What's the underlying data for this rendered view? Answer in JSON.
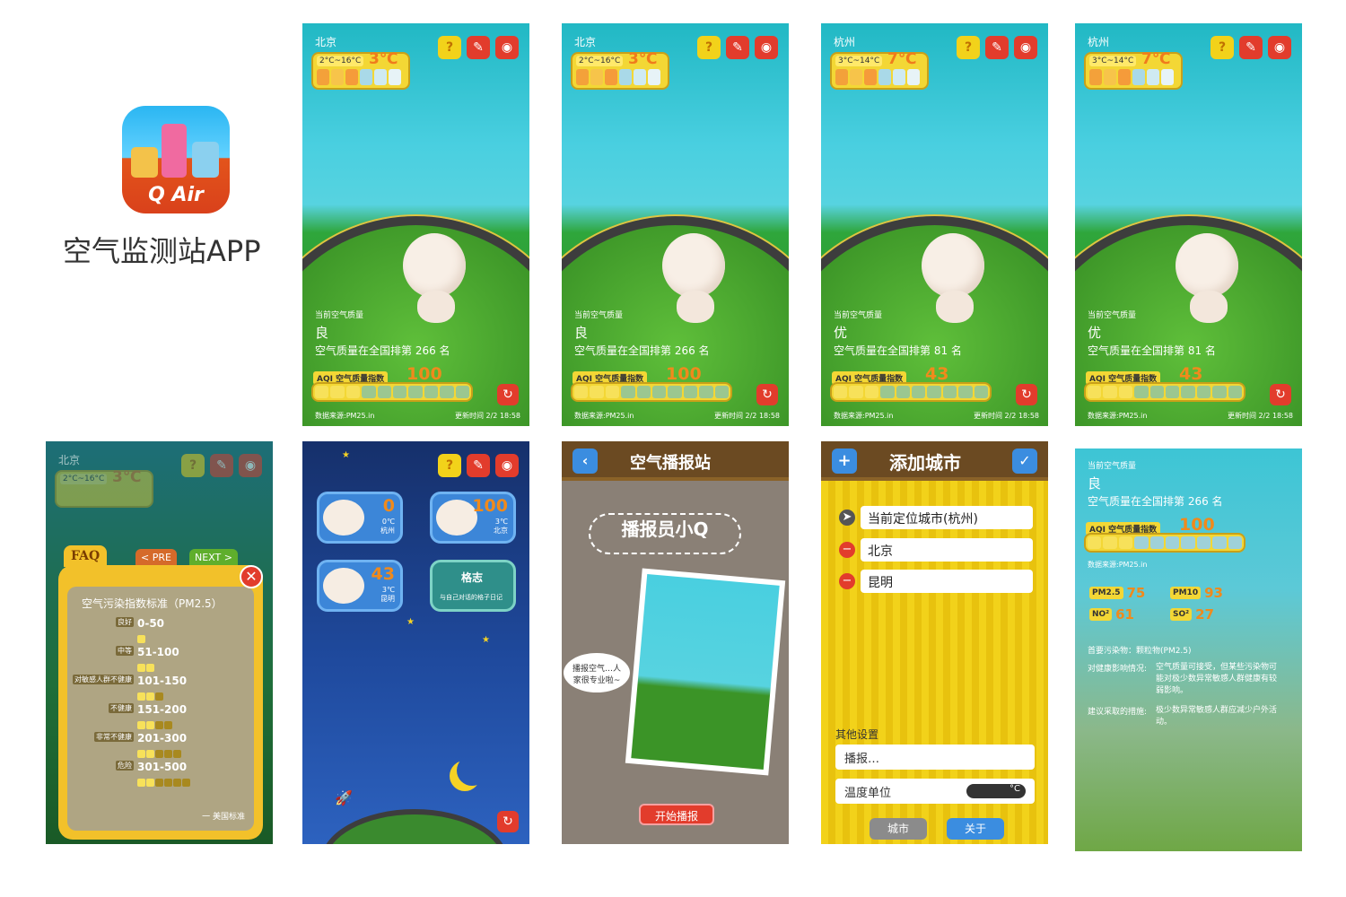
{
  "app": {
    "name": "空气监测站APP",
    "logo_text": "Q Air"
  },
  "icons": {
    "help": "?",
    "settings": "✎",
    "share": "◉",
    "refresh": "↻"
  },
  "screens": [
    {
      "city": "北京",
      "temp_range": "2°C~16°C",
      "temp": "3℃",
      "label": "当前空气质量",
      "level": "良",
      "rank": "空气质量在全国排第 266 名",
      "aqi_label": "AQI 空气质量指数",
      "aqi": "100",
      "source": "数据来源:PM25.in",
      "updated": "更新时间 2/2 18:58"
    },
    {
      "city": "北京",
      "temp_range": "2°C~16°C",
      "temp": "3℃",
      "label": "当前空气质量",
      "level": "良",
      "rank": "空气质量在全国排第 266 名",
      "aqi_label": "AQI 空气质量指数",
      "aqi": "100",
      "source": "数据来源:PM25.in",
      "updated": "更新时间 2/2 18:58"
    },
    {
      "city": "杭州",
      "temp_range": "3°C~14°C",
      "temp": "7℃",
      "label": "当前空气质量",
      "level": "优",
      "rank": "空气质量在全国排第 81 名",
      "aqi_label": "AQI 空气质量指数",
      "aqi": "43",
      "source": "数据来源:PM25.in",
      "updated": "更新时间 2/2 18:58"
    },
    {
      "city": "杭州",
      "temp_range": "3°C~14°C",
      "temp": "7℃",
      "label": "当前空气质量",
      "level": "优",
      "rank": "空气质量在全国排第 81 名",
      "aqi_label": "AQI 空气质量指数",
      "aqi": "43",
      "source": "数据来源:PM25.in",
      "updated": "更新时间 2/2 18:58"
    }
  ],
  "faq": {
    "city": "北京",
    "temp_range": "2°C~16°C",
    "temp": "3℃",
    "tab_faq": "FAQ",
    "tab_pre": "< PRE",
    "tab_next": "NEXT >",
    "title": "空气污染指数标准（PM2.5）",
    "rows": [
      {
        "tag": "良好",
        "range": "0-50"
      },
      {
        "tag": "中等",
        "range": "51-100"
      },
      {
        "tag": "对敏感人群不健康",
        "range": "101-150"
      },
      {
        "tag": "不健康",
        "range": "151-200"
      },
      {
        "tag": "非常不健康",
        "range": "201-300"
      },
      {
        "tag": "危险",
        "range": "301-500"
      }
    ],
    "footer": "一 美国标准"
  },
  "cities_grid": {
    "cards": [
      {
        "aqi": "0",
        "temp": "0℃",
        "city": "杭州"
      },
      {
        "aqi": "100",
        "temp": "3℃",
        "city": "北京"
      },
      {
        "aqi": "43",
        "temp": "3℃",
        "city": "昆明"
      }
    ],
    "ad_title": "格志",
    "ad_desc": "与自己对话的格子日记"
  },
  "broadcast": {
    "title": "空气播报站",
    "banner": "播报员小Q",
    "bubble": "播报空气…人家很专业啦~",
    "start": "开始播报"
  },
  "add_city": {
    "title": "添加城市",
    "cities": [
      "当前定位城市(杭州)",
      "北京",
      "昆明"
    ],
    "other_settings": "其他设置",
    "broadcast_item": "播报…",
    "temp_unit": "温度单位",
    "unit_value": "°C",
    "tab_city": "城市",
    "tab_about": "关于"
  },
  "detail": {
    "label": "当前空气质量",
    "level": "良",
    "rank": "空气质量在全国排第 266 名",
    "aqi_label": "AQI 空气质量指数",
    "aqi": "100",
    "source": "数据来源:PM25.in",
    "pm25_k": "PM2.5",
    "pm25_v": "75",
    "pm10_k": "PM10",
    "pm10_v": "93",
    "no2_k": "NO²",
    "no2_v": "61",
    "so2_k": "SO²",
    "so2_v": "27",
    "primary": "首要污染物：颗粒物(PM2.5)",
    "health_k": "对健康影响情况:",
    "health_v": "空气质量可接受，但某些污染物可能对极少数异常敏感人群健康有较弱影响。",
    "advice_k": "建议采取的措施:",
    "advice_v": "极少数异常敏感人群应减少户外活动。"
  }
}
